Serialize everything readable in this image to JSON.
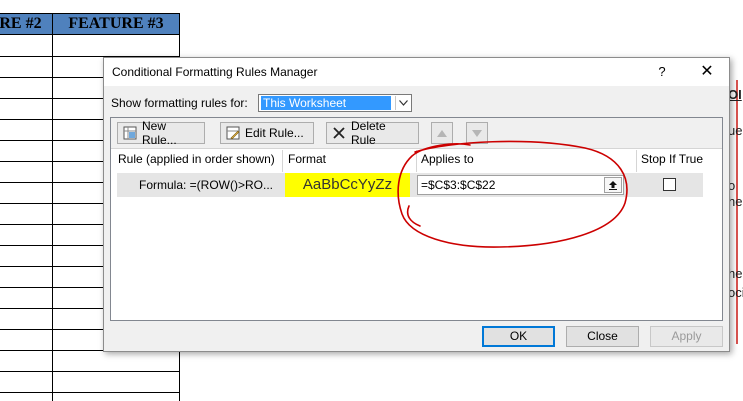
{
  "sheet": {
    "headers": [
      {
        "label": "RE #2"
      },
      {
        "label": "FEATURE #3"
      }
    ],
    "right_fragments": [
      "OI",
      "ue",
      "o",
      "he",
      "he",
      "oci"
    ]
  },
  "dialog": {
    "title": "Conditional Formatting Rules Manager",
    "help_label": "?",
    "close_label": "✕",
    "show_rules_label": "Show formatting rules for:",
    "show_rules_value": "This Worksheet",
    "toolbar": {
      "new_rule": "New Rule...",
      "edit_rule": "Edit Rule...",
      "delete_rule": "Delete Rule"
    },
    "columns": {
      "rule": "Rule (applied in order shown)",
      "format": "Format",
      "applies_to": "Applies to",
      "stop_if_true": "Stop If True"
    },
    "rules": [
      {
        "formula": "Formula: =(ROW()>RO...",
        "format_preview": "AaBbCcYyZz",
        "applies_to": "=$C$3:$C$22",
        "stop_if_true": false
      }
    ],
    "buttons": {
      "ok": "OK",
      "close": "Close",
      "apply": "Apply"
    },
    "colors": {
      "accent": "#0078d7",
      "selection": "#3399ff",
      "format_fill": "#ffff00",
      "annotation": "#cc0000",
      "header_fill": "#4f81bd"
    },
    "icons": [
      "new-rule-icon",
      "edit-rule-icon",
      "delete-x-icon",
      "move-up-icon",
      "move-down-icon",
      "collapse-dialog-icon",
      "dropdown-arrow-icon"
    ]
  }
}
